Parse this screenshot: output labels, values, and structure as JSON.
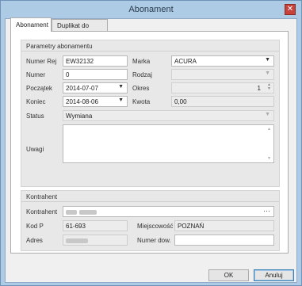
{
  "window": {
    "title": "Abonament"
  },
  "tabs": [
    {
      "label": "Abonament",
      "active": true
    },
    {
      "label": "Duplikat do",
      "active": false
    }
  ],
  "parametry": {
    "header": "Parametry abonamentu",
    "numer_rej": {
      "label": "Numer Rej",
      "value": "EW32132"
    },
    "marka": {
      "label": "Marka",
      "value": "ACURA"
    },
    "numer": {
      "label": "Numer",
      "value": "0"
    },
    "rodzaj": {
      "label": "Rodzaj",
      "value": ""
    },
    "poczatek": {
      "label": "Początek",
      "value": "2014-07-07"
    },
    "okres": {
      "label": "Okres",
      "value": "1"
    },
    "koniec": {
      "label": "Koniec",
      "value": "2014-08-06"
    },
    "kwota": {
      "label": "Kwota",
      "value": "0,00"
    },
    "status": {
      "label": "Status",
      "value": "Wymiana"
    },
    "uwagi": {
      "label": "Uwagi",
      "value": ""
    }
  },
  "kontrahent": {
    "header": "Kontrahent",
    "kontrahent": {
      "label": "Kontrahent",
      "value": ""
    },
    "kod_p": {
      "label": "Kod P",
      "value": "61-693"
    },
    "miejscowosc": {
      "label": "Miejscowość",
      "value": "POZNAŃ"
    },
    "adres": {
      "label": "Adres",
      "value": ""
    },
    "numer_dow": {
      "label": "Numer dow.",
      "value": ""
    }
  },
  "buttons": {
    "ok": "OK",
    "cancel": "Anuluj"
  },
  "icons": {
    "close": "close-icon",
    "dropdown": "chevron-down-icon",
    "spinner": "spinner-arrows-icon",
    "ellipsis": "ellipsis-icon"
  },
  "colors": {
    "titlebar": "#aecbe6",
    "close": "#c7423a",
    "group_bg": "#e8e8e8"
  }
}
